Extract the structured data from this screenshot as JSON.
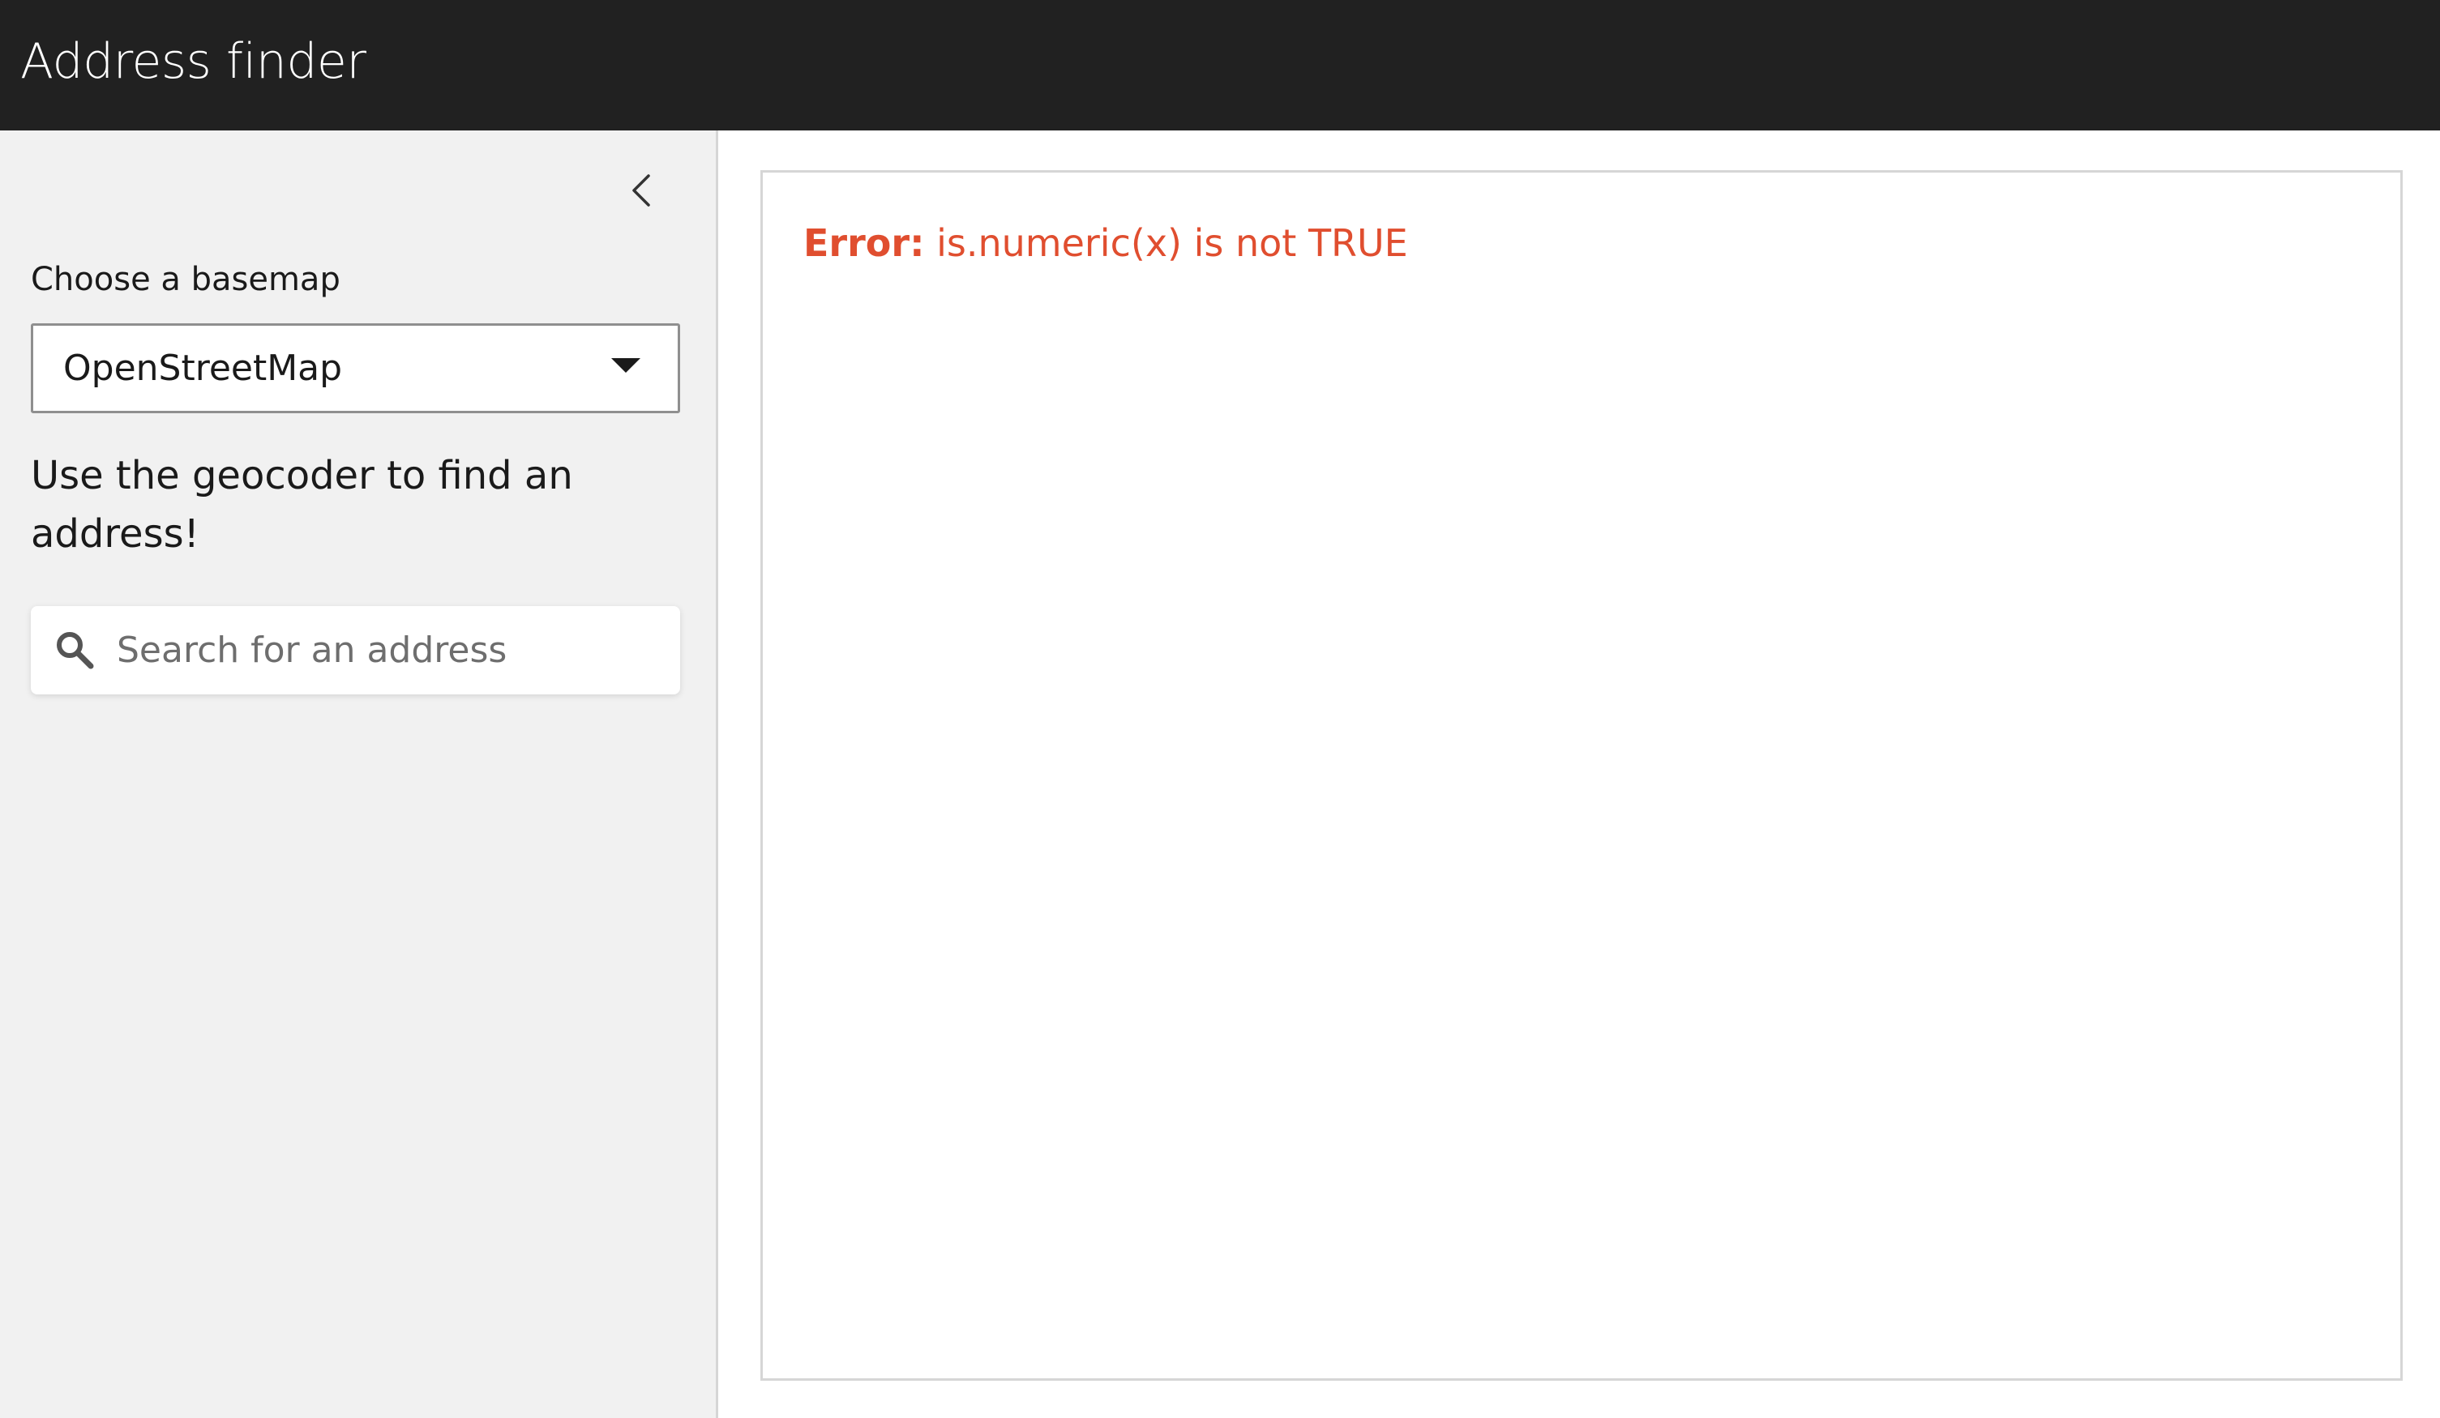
{
  "header": {
    "title": "Address finder"
  },
  "sidebar": {
    "collapse_icon": "chevron-left-icon",
    "basemap": {
      "label": "Choose a basemap",
      "selected": "OpenStreetMap"
    },
    "geocoder": {
      "hint": "Use the geocoder to find an address!",
      "placeholder": "Search for an address",
      "value": "",
      "icon": "search-icon"
    }
  },
  "main": {
    "error": {
      "prefix": "Error:",
      "message": "is.numeric(x) is not TRUE",
      "color": "#e04e2f"
    }
  },
  "colors": {
    "header_bg": "#212121",
    "sidebar_bg": "#f1f1f1"
  }
}
